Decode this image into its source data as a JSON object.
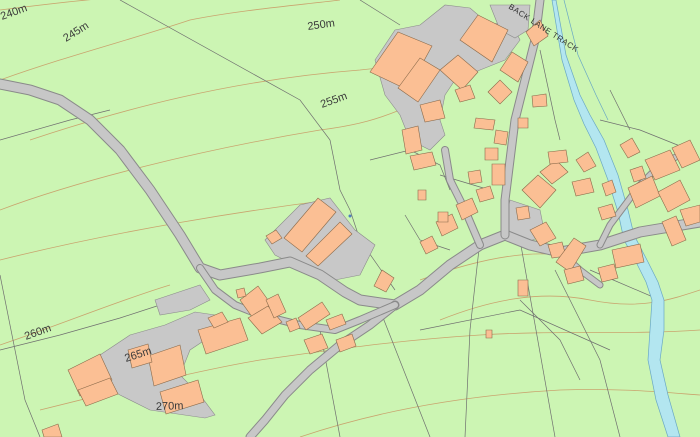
{
  "colors": {
    "land": "#ccf5b3",
    "road": "#c7c7c7",
    "building": "#fbbf94",
    "water": "#b3e6f0",
    "contour": "#c9a46e"
  },
  "map": {
    "contours": {
      "c240": "240m",
      "c245": "245m",
      "c250": "250m",
      "c255": "255m",
      "c260": "260m",
      "c265": "265m",
      "c270": "270m"
    },
    "roads": {
      "back_lane": "BACK LANE TRACK"
    }
  }
}
